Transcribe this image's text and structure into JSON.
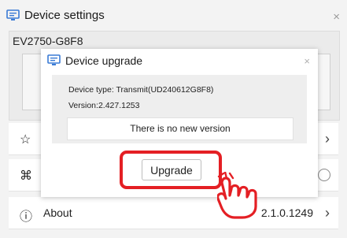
{
  "window": {
    "title": "Device settings",
    "close_glyph": "×"
  },
  "device": {
    "name": "EV2750-G8F8"
  },
  "rows": {
    "favorite_icon": "☆",
    "shortcut_icon": "⌘",
    "about_icon": "ⓘ",
    "about_label": "About",
    "about_version": "2.1.0.1249",
    "arrow_glyph": "›"
  },
  "modal": {
    "title": "Device upgrade",
    "close_glyph": "×",
    "device_type": "Device type: Transmit(UD240612G8F8)",
    "version": "Version:2.427.1253",
    "status": "There is no new version",
    "upgrade_label": "Upgrade"
  },
  "colors": {
    "highlight": "#e41f24",
    "accent_blue": "#3a7bd5"
  }
}
